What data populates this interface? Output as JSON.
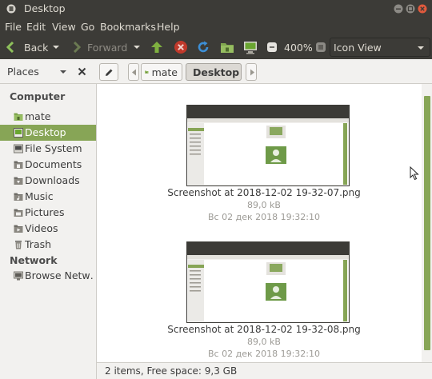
{
  "window": {
    "title": "Desktop"
  },
  "menubar": {
    "items": [
      "File",
      "Edit",
      "View",
      "Go",
      "Bookmarks",
      "Help"
    ]
  },
  "toolbar": {
    "back_label": "Back",
    "forward_label": "Forward",
    "zoom_label": "400%",
    "view_mode": "Icon View"
  },
  "locationbar": {
    "places_label": "Places",
    "path": [
      "mate",
      "Desktop"
    ]
  },
  "sidebar": {
    "computer_heading": "Computer",
    "computer_items": [
      {
        "label": "mate",
        "icon": "home-folder-icon"
      },
      {
        "label": "Desktop",
        "icon": "desktop-icon"
      },
      {
        "label": "File System",
        "icon": "drive-icon"
      },
      {
        "label": "Documents",
        "icon": "folder-icon"
      },
      {
        "label": "Downloads",
        "icon": "folder-icon"
      },
      {
        "label": "Music",
        "icon": "folder-icon"
      },
      {
        "label": "Pictures",
        "icon": "folder-icon"
      },
      {
        "label": "Videos",
        "icon": "folder-icon"
      },
      {
        "label": "Trash",
        "icon": "trash-icon"
      }
    ],
    "network_heading": "Network",
    "network_items": [
      {
        "label": "Browse Netw…",
        "icon": "network-icon"
      }
    ],
    "selected": "Desktop"
  },
  "files": [
    {
      "name": "Screenshot at 2018-12-02 19-32-07.png",
      "size": "89,0 kB",
      "date": "Вс 02 дек 2018 19:32:10"
    },
    {
      "name": "Screenshot at 2018-12-02 19-32-08.png",
      "size": "89,0 kB",
      "date": "Вс 02 дек 2018 19:32:10"
    }
  ],
  "status": {
    "text": "2 items, Free space: 9,3 GB"
  },
  "colors": {
    "accent": "#87a556",
    "titlebar": "#3c3b37",
    "window_bg": "#f2f1ef"
  }
}
